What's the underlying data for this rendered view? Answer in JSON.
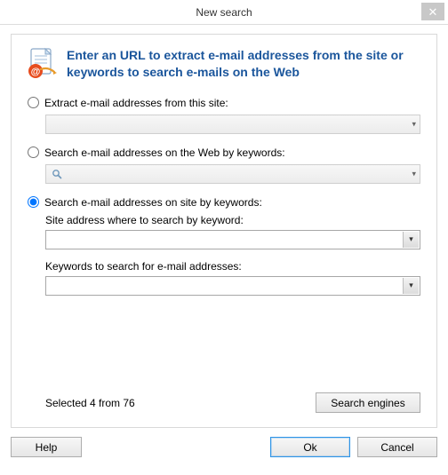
{
  "window": {
    "title": "New search"
  },
  "header": {
    "heading": "Enter an URL to extract e-mail addresses from the site or keywords to search e-mails on the Web"
  },
  "options": {
    "extract": {
      "label": "Extract e-mail addresses from this site:",
      "value": ""
    },
    "web": {
      "label": "Search e-mail addresses on the Web by keywords:",
      "value": ""
    },
    "site": {
      "label": "Search e-mail addresses on site by keywords:",
      "site_label": "Site address where to search by keyword:",
      "site_value": "",
      "keywords_label": "Keywords to search for e-mail addresses:",
      "keywords_value": ""
    },
    "selected": "site"
  },
  "status": {
    "text": "Selected 4 from 76"
  },
  "buttons": {
    "search_engines": "Search engines",
    "help": "Help",
    "ok": "Ok",
    "cancel": "Cancel"
  }
}
